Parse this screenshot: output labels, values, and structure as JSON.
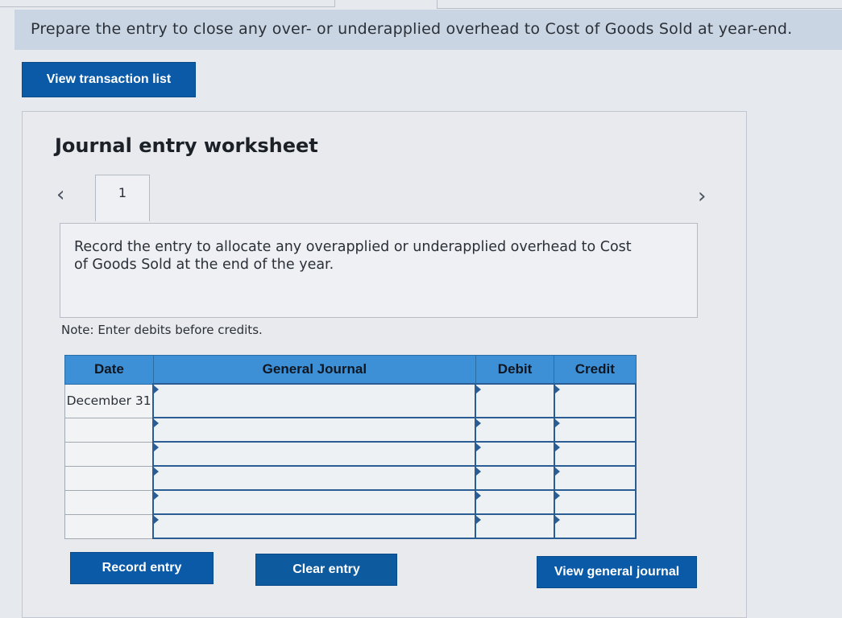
{
  "prompt": {
    "text": "Prepare the entry to close any over- or underapplied overhead to Cost of Goods Sold at year-end."
  },
  "buttons": {
    "view_transaction_list": "View transaction list",
    "record_entry": "Record entry",
    "clear_entry": "Clear entry",
    "view_general_journal": "View general journal"
  },
  "worksheet": {
    "title": "Journal entry worksheet",
    "nav_prev_icon": "chevron-left-icon",
    "nav_next_icon": "chevron-right-icon",
    "tabs": [
      {
        "label": "1"
      }
    ],
    "instruction": "Record the entry to allocate any overapplied or underapplied overhead to Cost of Goods Sold at the end of the year.",
    "note": "Note: Enter debits before credits.",
    "table": {
      "headers": [
        "Date",
        "General Journal",
        "Debit",
        "Credit"
      ],
      "rows": [
        {
          "date": "December 31",
          "account": "",
          "debit": "",
          "credit": ""
        },
        {
          "date": "",
          "account": "",
          "debit": "",
          "credit": ""
        },
        {
          "date": "",
          "account": "",
          "debit": "",
          "credit": ""
        },
        {
          "date": "",
          "account": "",
          "debit": "",
          "credit": ""
        },
        {
          "date": "",
          "account": "",
          "debit": "",
          "credit": ""
        },
        {
          "date": "",
          "account": "",
          "debit": "",
          "credit": ""
        }
      ]
    }
  },
  "colors": {
    "button_bg": "#0a5aa8",
    "table_header_bg": "#3d90d6",
    "prompt_band_bg": "#c9d5e2"
  }
}
